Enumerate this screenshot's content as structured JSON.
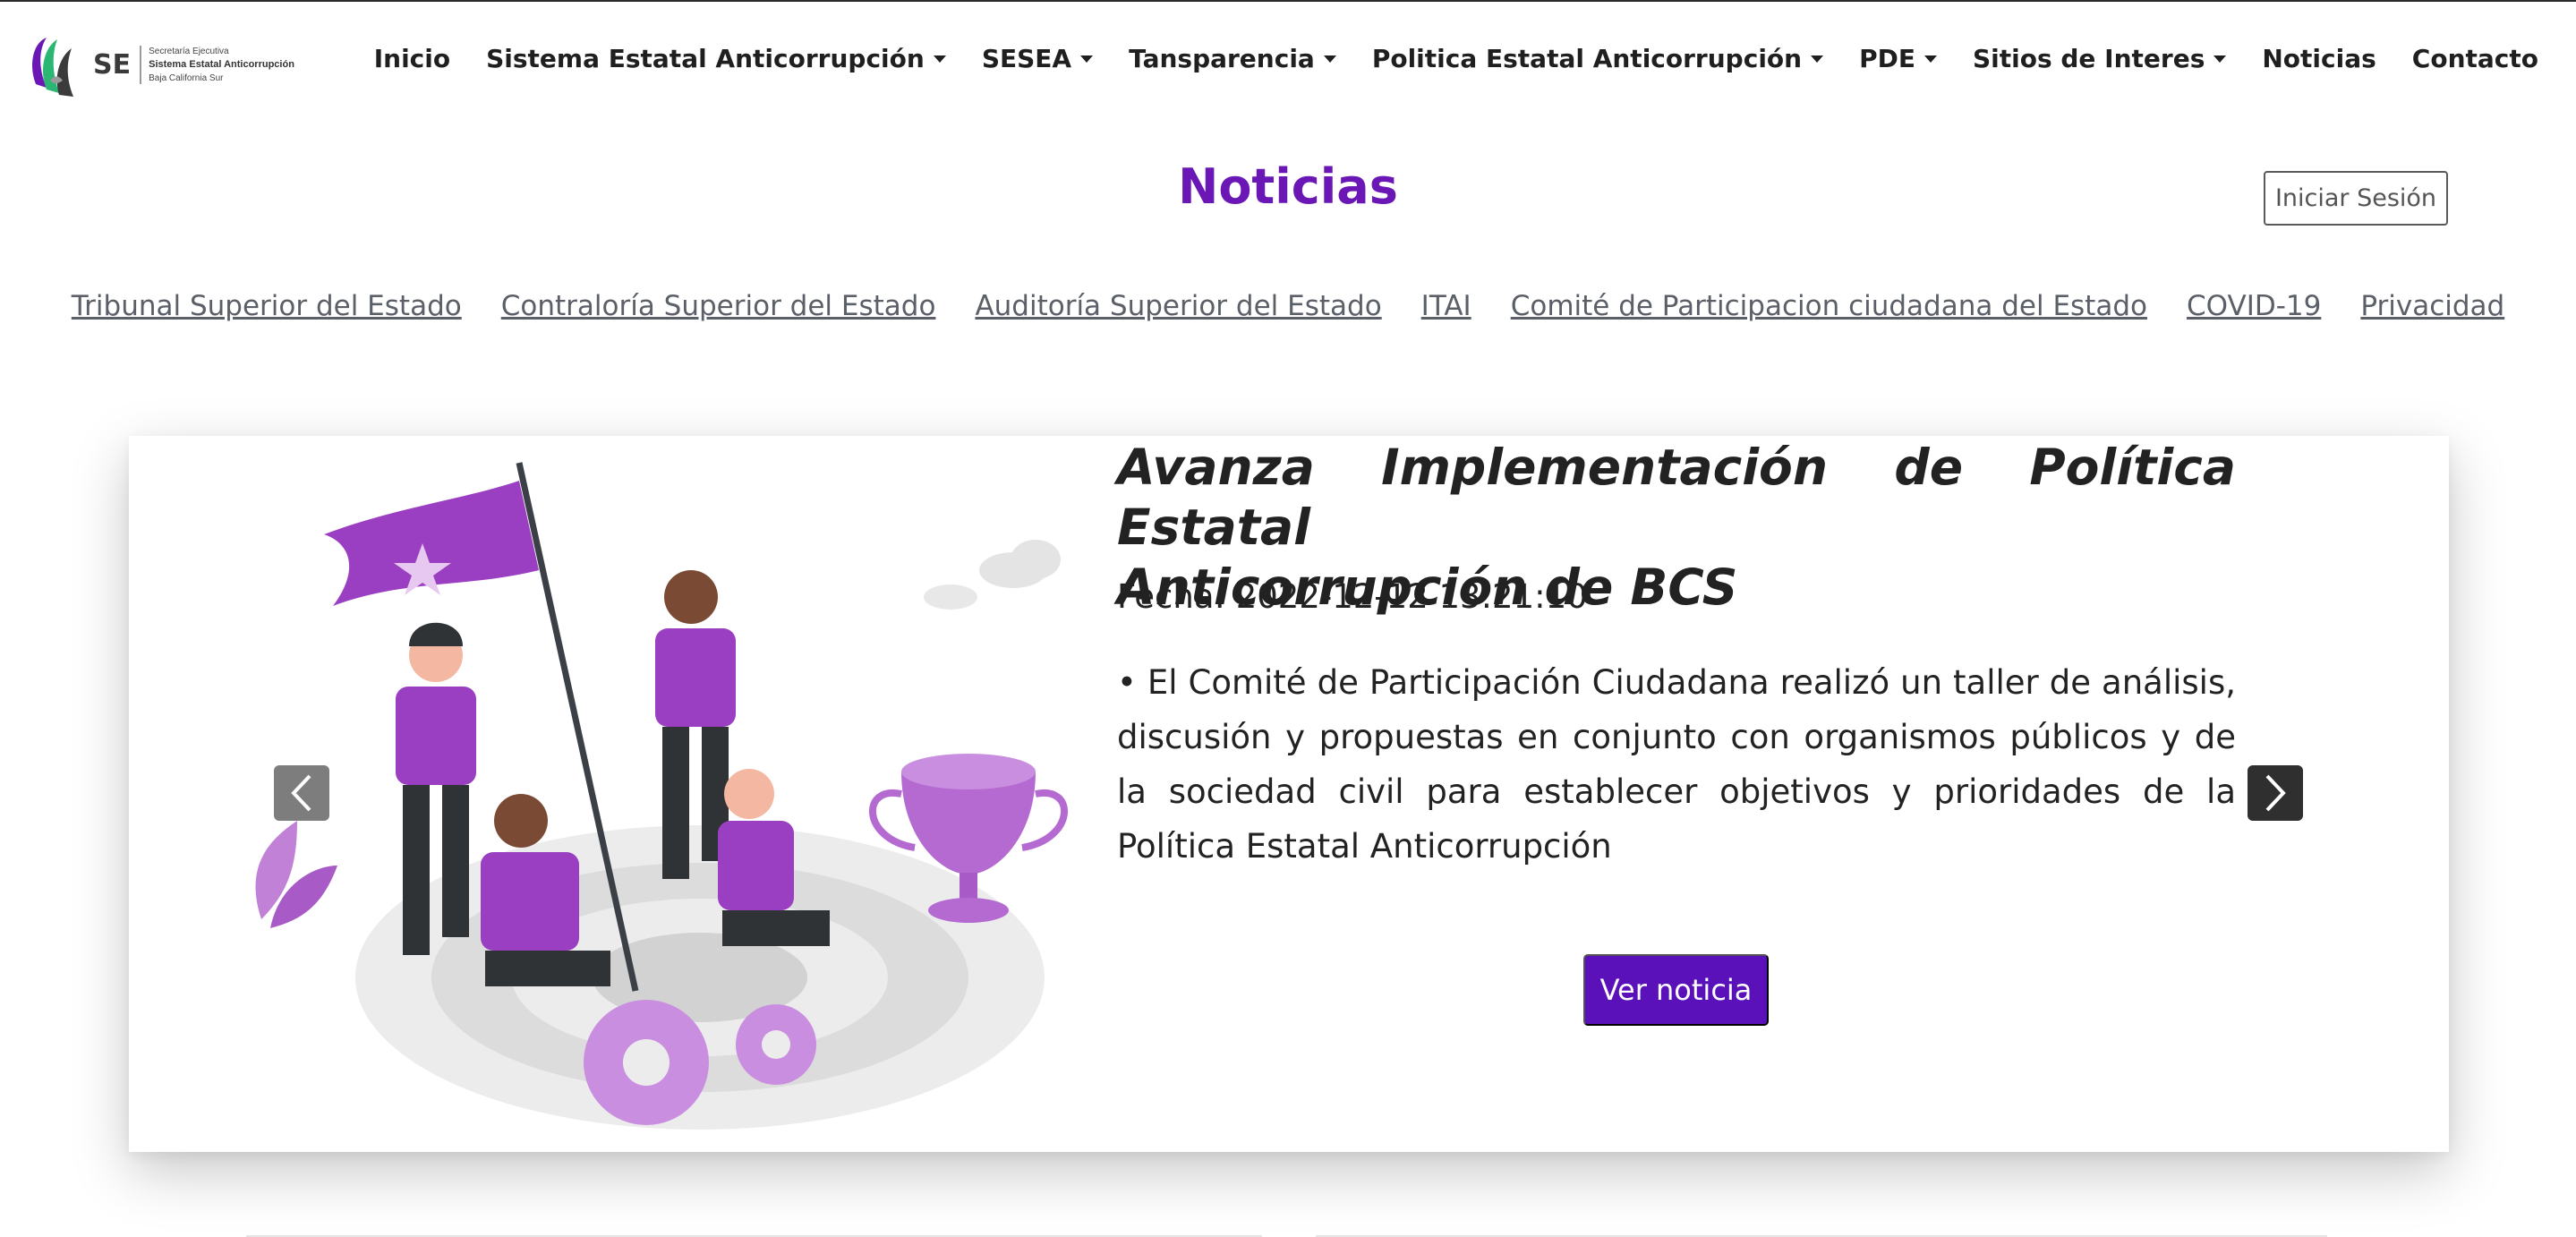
{
  "brand": {
    "abbr": "SE",
    "line1": "Secretaría Ejecutiva",
    "line2": "Sistema Estatal Anticorrupción",
    "line3": "Baja California Sur",
    "accent": "#6a17b6"
  },
  "nav": {
    "inicio": "Inicio",
    "sistema": "Sistema Estatal Anticorrupción",
    "sesea": "SESEA",
    "transparencia": "Tansparencia",
    "politica": "Politica Estatal Anticorrupción",
    "pde": "PDE",
    "sitios": "Sitios de Interes",
    "noticias": "Noticias",
    "contacto": "Contacto"
  },
  "page": {
    "title": "Noticias",
    "login_label": "Iniciar Sesión"
  },
  "links": [
    "Tribunal Superior del Estado",
    "Contraloría Superior del Estado",
    "Auditoría Superior del Estado",
    "ITAI",
    "Comité de Participacion ciudadana del Estado",
    "COVID-19",
    "Privacidad"
  ],
  "news": {
    "title_line1": "Avanza Implementación de Política Estatal",
    "title_line2": "Anticorrupción de BCS",
    "date": "Fecha: 2022-12-12 13:21:10",
    "body": "• El Comité de Participación Ciudadana realizó un taller de análisis, discusión y propuestas en conjunto con organismos públicos y de la sociedad civil para establecer objetivos y prioridades de la Política Estatal Anticorrupción",
    "button_label": "Ver noticia",
    "button_color": "#5b11b9"
  },
  "icons": {
    "prev": "chevron-left-icon",
    "next": "chevron-right-icon",
    "dropdown": "caret-down-icon"
  }
}
